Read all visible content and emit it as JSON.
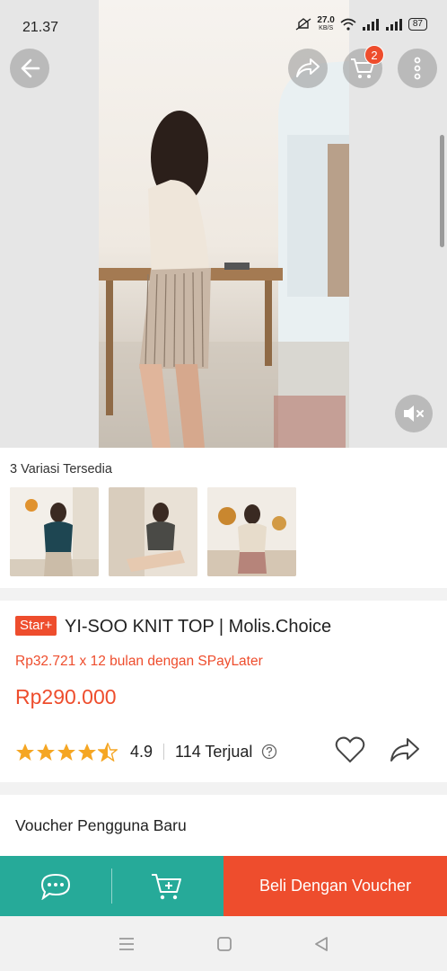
{
  "status_bar": {
    "time": "21.37",
    "net_speed": "27.0",
    "net_unit": "KB/S",
    "battery": "87"
  },
  "header": {
    "cart_count": "2"
  },
  "variations": {
    "title": "3 Variasi Tersedia",
    "thumbnails": [
      "variant-1",
      "variant-2",
      "variant-3"
    ]
  },
  "product": {
    "badge": "Star+",
    "title": "YI-SOO KNIT TOP | Molis.Choice",
    "installment": "Rp32.721 x 12 bulan dengan SPayLater",
    "price": "Rp290.000",
    "rating": "4.9",
    "rating_stars": 4.5,
    "sold": "114 Terjual"
  },
  "voucher": {
    "label": "Voucher Pengguna Baru"
  },
  "bottom_bar": {
    "buy_label": "Beli Dengan Voucher"
  },
  "colors": {
    "accent": "#ee4d2d",
    "teal": "#26aa99",
    "star": "#f5a623"
  },
  "icons": [
    "back-arrow-icon",
    "share-icon",
    "cart-icon",
    "more-icon",
    "mute-icon",
    "heart-icon",
    "chat-icon",
    "add-to-cart-icon",
    "help-icon",
    "menu-icon",
    "home-icon",
    "back-nav-icon"
  ]
}
